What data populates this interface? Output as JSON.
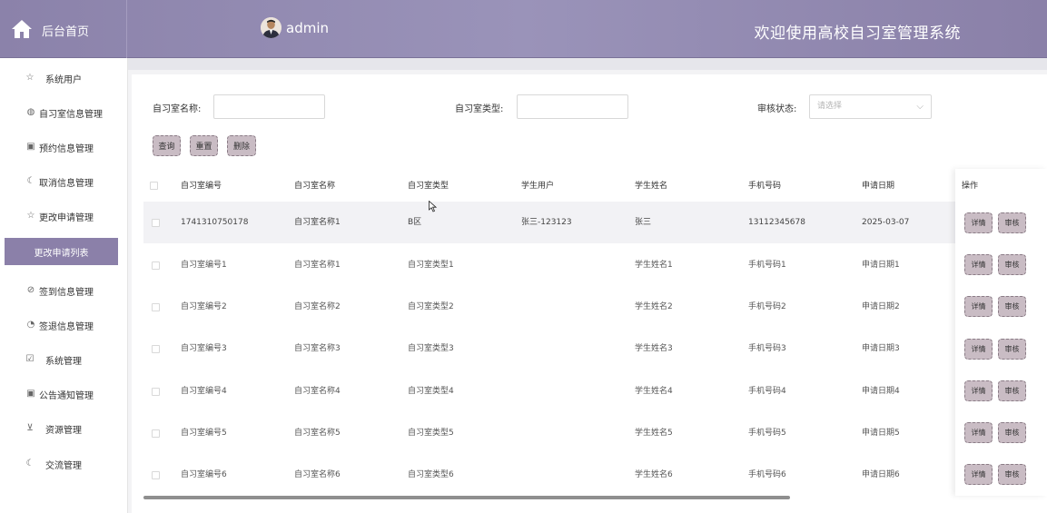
{
  "header": {
    "home_label": "后台首页",
    "user_name": "admin",
    "system_title": "欢迎使用高校自习室管理系统"
  },
  "sidebar": {
    "items": [
      {
        "label": "系统用户",
        "icon": "star-icon"
      },
      {
        "label": "自习室信息管理",
        "icon": "drop-icon"
      },
      {
        "label": "预约信息管理",
        "icon": "gift-icon"
      },
      {
        "label": "取消信息管理",
        "icon": "moon-icon"
      },
      {
        "label": "更改申请管理",
        "icon": "star-icon"
      },
      {
        "label": "更改申请列表",
        "icon": "",
        "active": true
      },
      {
        "label": "签到信息管理",
        "icon": "compass-icon"
      },
      {
        "label": "签退信息管理",
        "icon": "timer-icon"
      },
      {
        "label": "系统管理",
        "icon": "check-box-icon"
      },
      {
        "label": "公告通知管理",
        "icon": "gift-icon"
      },
      {
        "label": "资源管理",
        "icon": "download-box-icon"
      },
      {
        "label": "交流管理",
        "icon": "moon-icon"
      }
    ]
  },
  "filters": {
    "room_name_label": "自习室名称:",
    "room_type_label": "自习室类型:",
    "status_label": "审核状态:",
    "status_placeholder": "请选择"
  },
  "actions": {
    "search": "查询",
    "reset": "重置",
    "delete": "删除"
  },
  "table": {
    "columns": [
      "自习室编号",
      "自习室名称",
      "自习室类型",
      "学生用户",
      "学生姓名",
      "手机号码",
      "申请日期"
    ],
    "op_column": "操作",
    "detail": "详情",
    "review": "审核",
    "rows": [
      [
        "1741310750178",
        "自习室名称1",
        "B区",
        "张三-123123",
        "张三",
        "13112345678",
        "2025-03-07"
      ],
      [
        "自习室编号1",
        "自习室名称1",
        "自习室类型1",
        "",
        "学生姓名1",
        "手机号码1",
        "申请日期1"
      ],
      [
        "自习室编号2",
        "自习室名称2",
        "自习室类型2",
        "",
        "学生姓名2",
        "手机号码2",
        "申请日期2"
      ],
      [
        "自习室编号3",
        "自习室名称3",
        "自习室类型3",
        "",
        "学生姓名3",
        "手机号码3",
        "申请日期3"
      ],
      [
        "自习室编号4",
        "自习室名称4",
        "自习室类型4",
        "",
        "学生姓名4",
        "手机号码4",
        "申请日期4"
      ],
      [
        "自习室编号5",
        "自习室名称5",
        "自习室类型5",
        "",
        "学生姓名5",
        "手机号码5",
        "申请日期5"
      ],
      [
        "自习室编号6",
        "自习室名称6",
        "自习室类型6",
        "",
        "学生姓名6",
        "手机号码6",
        "申请日期6"
      ]
    ]
  },
  "colors": {
    "header": "#9a93b9",
    "accent": "#8b80a9",
    "button": "#c9bcc4"
  }
}
